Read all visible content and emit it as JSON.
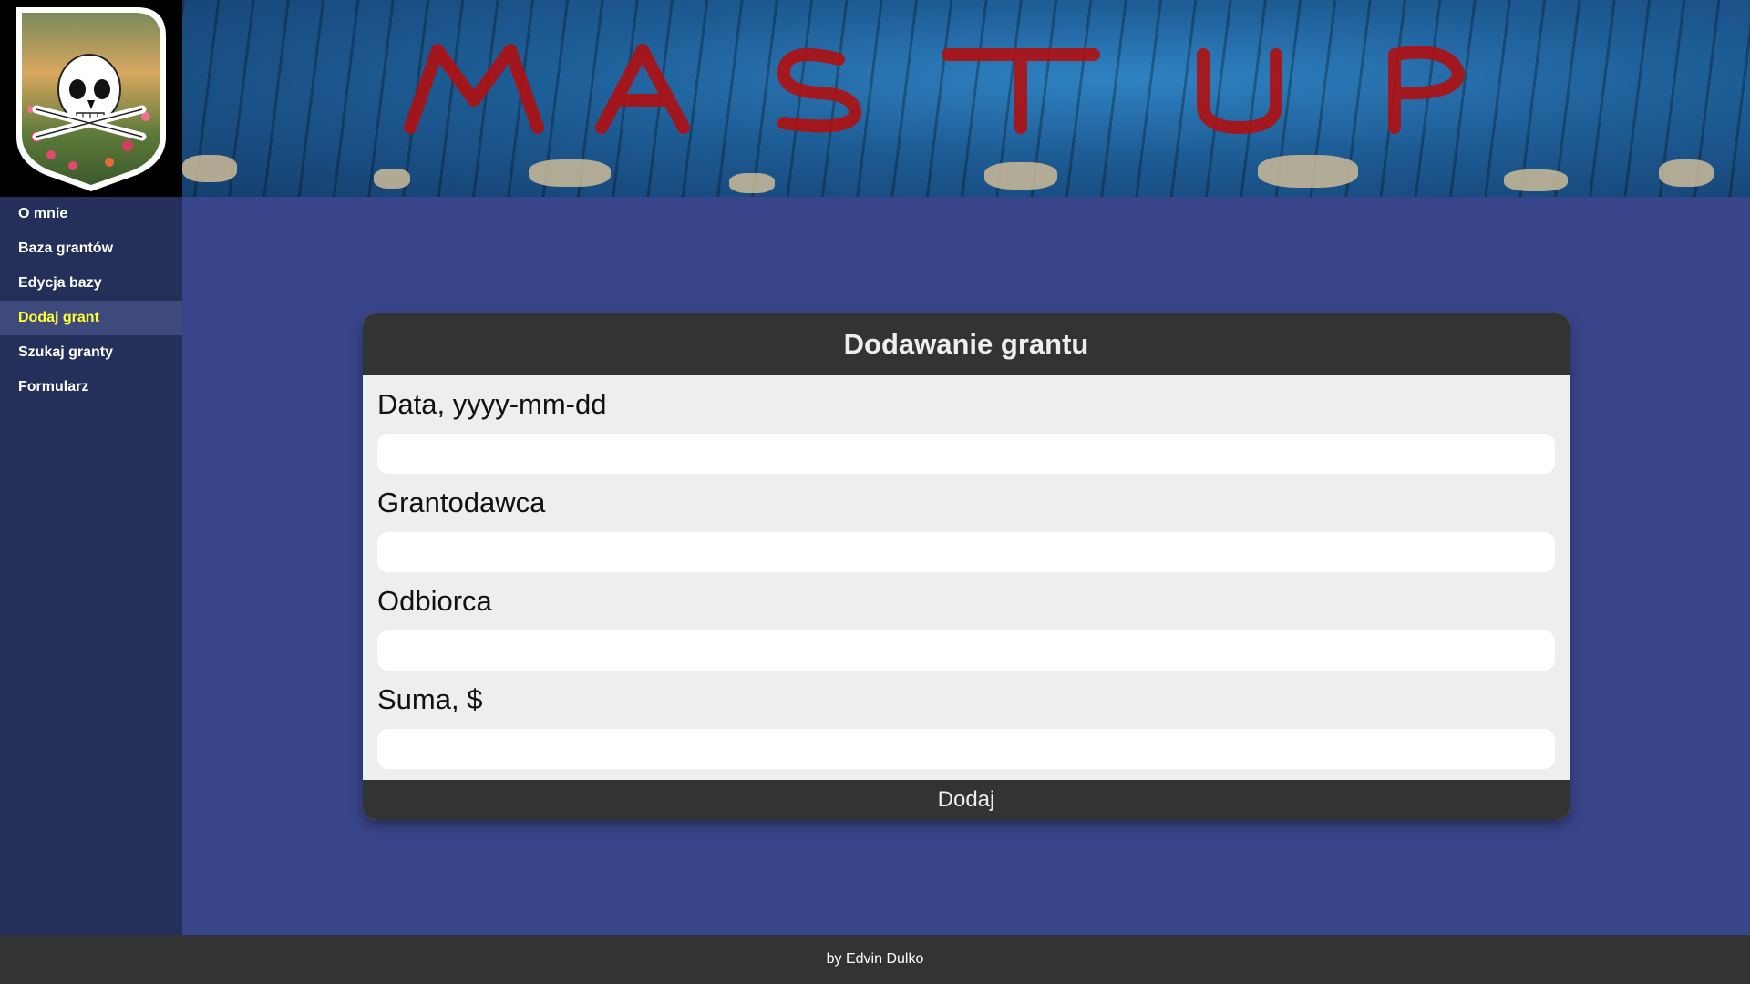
{
  "logo": {
    "icon": "skull-crest-icon"
  },
  "banner": {
    "text": "MASTUP",
    "colors": {
      "wall": "#1e5d96",
      "paint": "#b01010"
    }
  },
  "sidebar": {
    "items": [
      {
        "label": "O mnie",
        "active": false
      },
      {
        "label": "Baza grantów",
        "active": false
      },
      {
        "label": "Edycja bazy",
        "active": false
      },
      {
        "label": "Dodaj grant",
        "active": true
      },
      {
        "label": "Szukaj granty",
        "active": false
      },
      {
        "label": "Formularz",
        "active": false
      }
    ],
    "active_color": "#ffff33"
  },
  "form": {
    "title": "Dodawanie grantu",
    "fields": [
      {
        "label": "Data, yyyy-mm-dd",
        "value": "",
        "placeholder": ""
      },
      {
        "label": "Grantodawca",
        "value": "",
        "placeholder": ""
      },
      {
        "label": "Odbiorca",
        "value": "",
        "placeholder": ""
      },
      {
        "label": "Suma, $",
        "value": "",
        "placeholder": ""
      }
    ],
    "submit_label": "Dodaj"
  },
  "footer": {
    "text": "by Edvin Dulko"
  },
  "colors": {
    "page_bg": "#38458a",
    "sidebar_bg": "#242f5a",
    "card_header_bg": "#333333",
    "card_body_bg": "#eeeeee"
  }
}
